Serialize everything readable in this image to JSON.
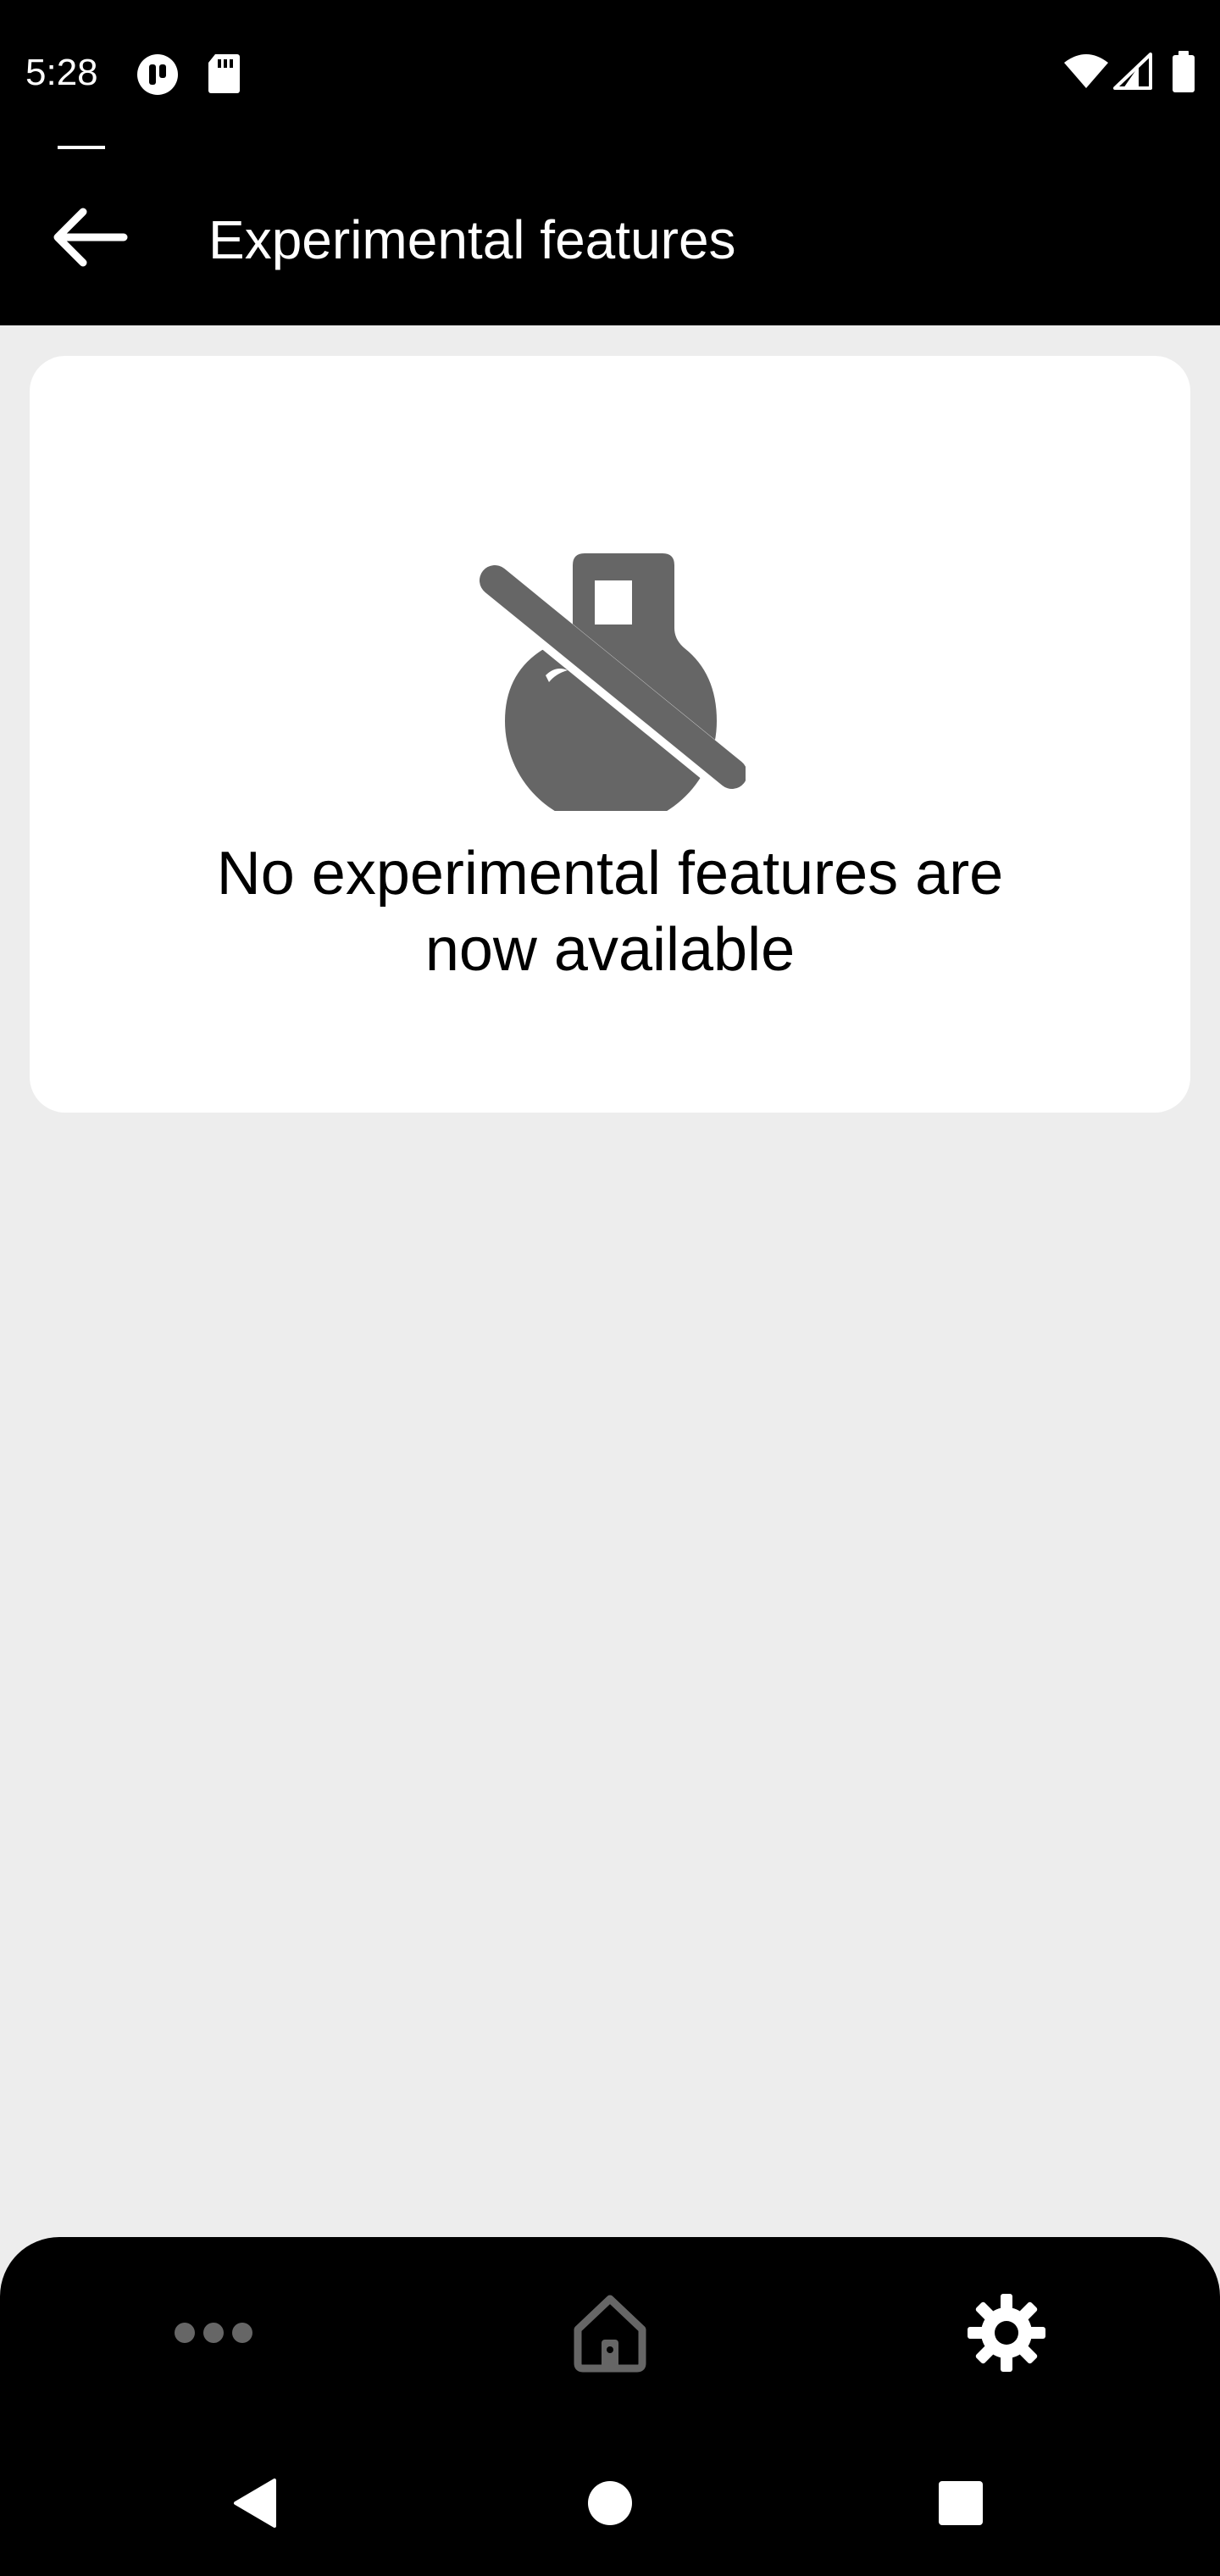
{
  "status_bar": {
    "time": "5:28",
    "icons": [
      "media-notification-icon",
      "sd-card-icon",
      "wifi-icon",
      "cell-signal-icon",
      "battery-icon"
    ]
  },
  "header": {
    "title": "Experimental features",
    "back_icon": "arrow-back-icon"
  },
  "empty_state": {
    "icon": "science-off-icon",
    "message_line1": "No experimental features are",
    "message_line2": "now available"
  },
  "bottom_nav": {
    "items": [
      {
        "icon": "more-horiz-icon",
        "active": false
      },
      {
        "icon": "home-icon",
        "active": false
      },
      {
        "icon": "settings-icon",
        "active": true
      }
    ]
  },
  "system_nav": {
    "items": [
      "back-triangle-icon",
      "home-circle-icon",
      "recents-square-icon"
    ]
  },
  "colors": {
    "bar_background": "#000000",
    "page_background": "#ededed",
    "card_background": "#ffffff",
    "icon_gray": "#666666",
    "active_icon": "#ffffff",
    "inactive_icon": "#666666"
  }
}
